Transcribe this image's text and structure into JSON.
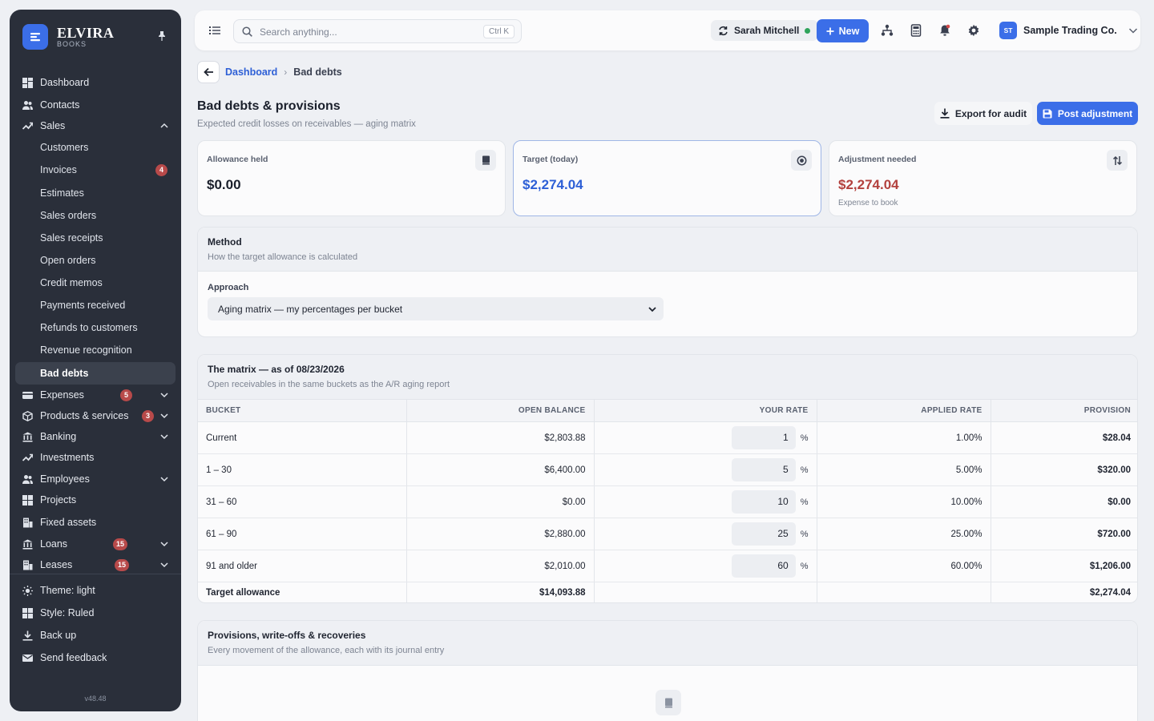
{
  "brand": {
    "name": "ELVIRA",
    "sub": "BOOKS"
  },
  "sidebar": {
    "items": [
      {
        "key": "dashboard",
        "label": "Dashboard"
      },
      {
        "key": "contacts",
        "label": "Contacts"
      },
      {
        "key": "sales",
        "label": "Sales"
      },
      {
        "key": "customers",
        "label": "Customers"
      },
      {
        "key": "invoices",
        "label": "Invoices",
        "badge": "4"
      },
      {
        "key": "estimates",
        "label": "Estimates"
      },
      {
        "key": "sales-orders",
        "label": "Sales orders"
      },
      {
        "key": "sales-receipts",
        "label": "Sales receipts"
      },
      {
        "key": "open-orders",
        "label": "Open orders"
      },
      {
        "key": "credit-memos",
        "label": "Credit memos"
      },
      {
        "key": "payments-received",
        "label": "Payments received"
      },
      {
        "key": "refunds",
        "label": "Refunds to customers"
      },
      {
        "key": "revenue-recognition",
        "label": "Revenue recognition"
      },
      {
        "key": "bad-debts",
        "label": "Bad debts"
      },
      {
        "key": "expenses",
        "label": "Expenses",
        "badge": "5"
      },
      {
        "key": "products",
        "label": "Products & services",
        "badge": "3"
      },
      {
        "key": "banking",
        "label": "Banking"
      },
      {
        "key": "investments",
        "label": "Investments"
      },
      {
        "key": "employees",
        "label": "Employees"
      },
      {
        "key": "projects",
        "label": "Projects"
      },
      {
        "key": "fixed-assets",
        "label": "Fixed assets"
      },
      {
        "key": "loans",
        "label": "Loans",
        "badge": "15"
      },
      {
        "key": "leases",
        "label": "Leases",
        "badge": "15"
      }
    ],
    "bottom": [
      {
        "key": "theme",
        "label": "Theme: light"
      },
      {
        "key": "style",
        "label": "Style: Ruled"
      },
      {
        "key": "backup",
        "label": "Back up"
      },
      {
        "key": "feedback",
        "label": "Send feedback"
      }
    ],
    "version": "v48.48"
  },
  "topbar": {
    "search_placeholder": "Search anything...",
    "shortcut": "Ctrl K",
    "user": "Sarah Mitchell",
    "new_label": "New",
    "company_initials": "ST",
    "company": "Sample Trading Co."
  },
  "breadcrumb": {
    "parent": "Dashboard",
    "current": "Bad debts"
  },
  "page": {
    "title": "Bad debts & provisions",
    "subtitle": "Expected credit losses on receivables — aging matrix",
    "export_label": "Export for audit",
    "post_label": "Post adjustment"
  },
  "stats": {
    "allowance": {
      "label": "Allowance held",
      "value": "$0.00"
    },
    "target": {
      "label": "Target (today)",
      "value": "$2,274.04"
    },
    "adjustment": {
      "label": "Adjustment needed",
      "value": "$2,274.04",
      "note": "Expense to book"
    }
  },
  "method": {
    "title": "Method",
    "subtitle": "How the target allowance is calculated",
    "approach_label": "Approach",
    "approach_value": "Aging matrix — my percentages per bucket"
  },
  "matrix": {
    "title": "The matrix — as of 08/23/2026",
    "subtitle": "Open receivables in the same buckets as the A/R aging report",
    "columns": [
      "Bucket",
      "Open balance",
      "Your rate",
      "Applied rate",
      "Provision"
    ],
    "rows": [
      {
        "bucket": "Current",
        "balance": "$2,803.88",
        "rate": "1",
        "applied": "1.00%",
        "provision": "$28.04"
      },
      {
        "bucket": "1 – 30",
        "balance": "$6,400.00",
        "rate": "5",
        "applied": "5.00%",
        "provision": "$320.00"
      },
      {
        "bucket": "31 – 60",
        "balance": "$0.00",
        "rate": "10",
        "applied": "10.00%",
        "provision": "$0.00"
      },
      {
        "bucket": "61 – 90",
        "balance": "$2,880.00",
        "rate": "25",
        "applied": "25.00%",
        "provision": "$720.00"
      },
      {
        "bucket": "91 and older",
        "balance": "$2,010.00",
        "rate": "60",
        "applied": "60.00%",
        "provision": "$1,206.00"
      }
    ],
    "pct_symbol": "%",
    "total": {
      "label": "Target allowance",
      "balance": "$14,093.88",
      "provision": "$2,274.04"
    }
  },
  "movements": {
    "title": "Provisions, write-offs & recoveries",
    "subtitle": "Every movement of the allowance, each with its journal entry"
  },
  "colors": {
    "accent": "#3b6ee8",
    "sidebar": "#2a2f3a",
    "negative": "#b3413e",
    "target": "#2d5fd6"
  }
}
